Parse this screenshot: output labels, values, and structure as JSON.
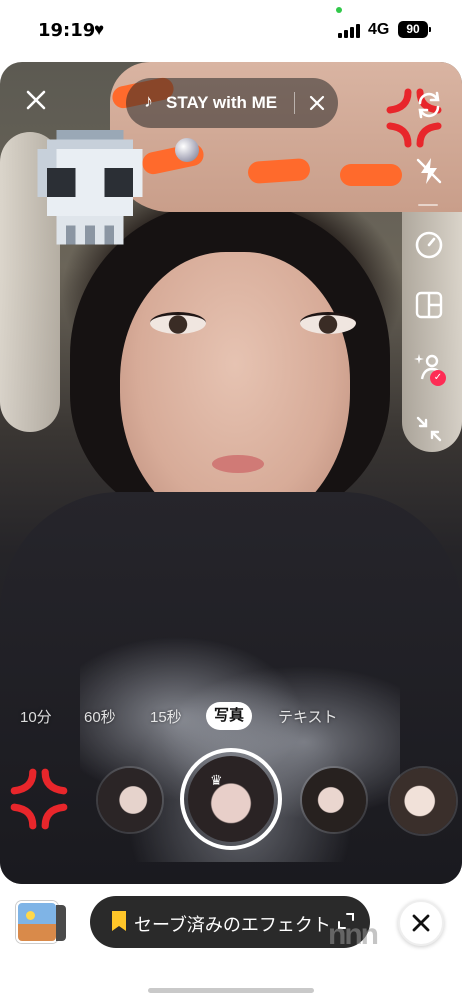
{
  "status_bar": {
    "time": "19:19",
    "heart_icon": "heart",
    "network": "4G",
    "battery": "90",
    "signal_icon": "cellular-signal"
  },
  "top_bar": {
    "close_icon": "close",
    "music": {
      "note_icon": "music-note",
      "title": "STAY with ME",
      "remove_icon": "close"
    }
  },
  "sidebar": {
    "items": [
      {
        "name": "flip-camera",
        "icon": "flip-camera-icon"
      },
      {
        "name": "flash",
        "icon": "flash-off-icon"
      },
      {
        "name": "timer",
        "icon": "timer-icon"
      },
      {
        "name": "layout",
        "icon": "layout-icon"
      },
      {
        "name": "collab",
        "icon": "sparkle-person-icon"
      },
      {
        "name": "collapse",
        "icon": "collapse-icon"
      }
    ]
  },
  "modes": {
    "items": [
      "10分",
      "60秒",
      "15秒",
      "写真",
      "テキスト"
    ],
    "active": "写真"
  },
  "effects": {
    "selected_index": 1
  },
  "bottom_bar": {
    "saved_effects_label": "セーブ済みのエフェクト",
    "close_icon": "close",
    "watermark": "nnn"
  },
  "colors": {
    "accent_red": "#fe2c55",
    "bookmark_yellow": "#ffc629",
    "nail_orange": "#ff6a2c",
    "sticker_red": "#e8262b"
  }
}
